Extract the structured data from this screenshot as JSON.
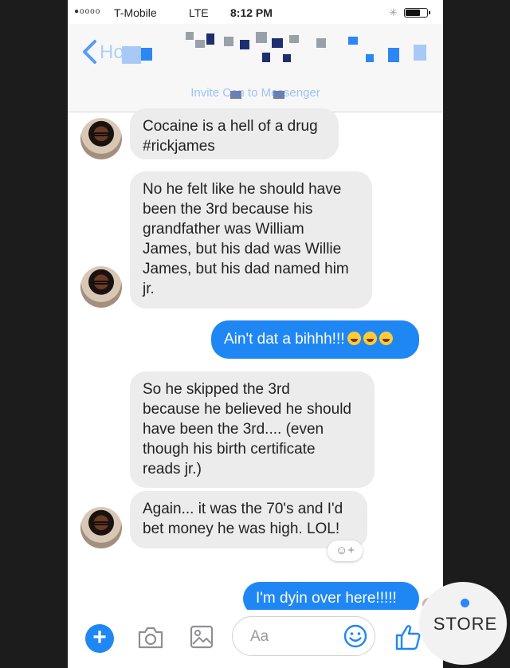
{
  "status_bar": {
    "signal": "●oooo",
    "carrier": "T-Mobile",
    "network": "LTE",
    "time": "8:12 PM"
  },
  "header": {
    "back_label": "Ho",
    "invite_text": "Invite Con to Messenger"
  },
  "messages": [
    {
      "direction": "incoming",
      "lines": [
        "Cocaine is a hell of a drug",
        "#rickjames"
      ]
    },
    {
      "direction": "incoming",
      "lines": [
        "No he felt like he should have",
        "been the 3rd because his",
        "grandfather was William",
        "James, but his dad was Willie",
        "James, but his dad named him",
        "jr."
      ]
    },
    {
      "direction": "outgoing",
      "text": "Ain't dat a bihhh!!!",
      "emoji": [
        "joy-emoji",
        "joy-emoji",
        "joy-emoji"
      ]
    },
    {
      "direction": "incoming",
      "lines": [
        "So he skipped the 3rd",
        "because he believed he should",
        "have been the 3rd.... (even",
        "though his birth certificate",
        "reads jr.)"
      ]
    },
    {
      "direction": "incoming",
      "lines": [
        "Again... it was the 70's and I'd",
        "bet money he was high. LOL!"
      ]
    },
    {
      "direction": "outgoing",
      "text": "I'm dyin over here!!!!!"
    }
  ],
  "reaction_button": "☺+",
  "composer": {
    "plus_label": "+",
    "placeholder": "Aa"
  },
  "store_button": {
    "label": "STORE"
  },
  "colors": {
    "accent": "#1f87f4",
    "incoming_bubble": "#ececed",
    "background": "#1c1c1c"
  }
}
